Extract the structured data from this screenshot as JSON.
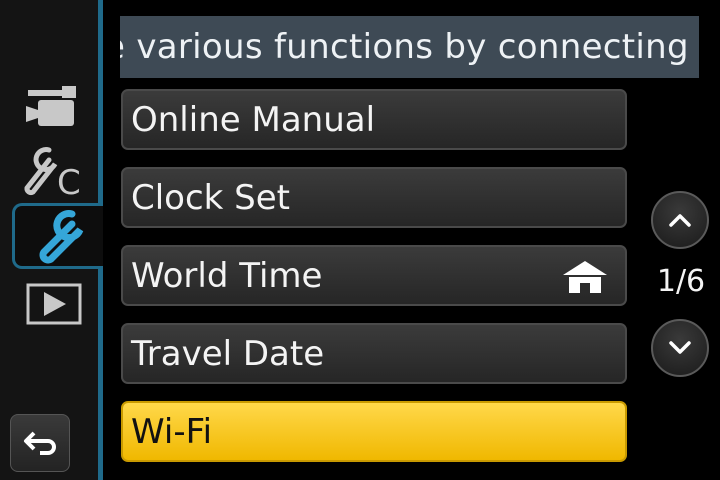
{
  "banner": {
    "text": "e various functions by connecting"
  },
  "sidebar": {
    "tabs": [
      {
        "name": "motion-picture",
        "icon": "movie-camera-icon",
        "active": false
      },
      {
        "name": "custom",
        "icon": "wrench-c-icon",
        "active": false
      },
      {
        "name": "setup",
        "icon": "wrench-icon",
        "active": true
      },
      {
        "name": "playback",
        "icon": "play-icon",
        "active": false
      }
    ],
    "back_icon": "return-arrow-icon"
  },
  "menu": {
    "items": [
      {
        "label": "Online Manual"
      },
      {
        "label": "Clock Set"
      },
      {
        "label": "World Time",
        "icon": "home-icon"
      },
      {
        "label": "Travel Date"
      },
      {
        "label": "Wi-Fi",
        "selected": true
      }
    ]
  },
  "pager": {
    "indicator": "1/6",
    "up_icon": "chevron-up-icon",
    "down_icon": "chevron-down-icon"
  },
  "colors": {
    "accent": "#1f6a8a",
    "selected": "#f5c518",
    "banner": "#3e4a55"
  }
}
